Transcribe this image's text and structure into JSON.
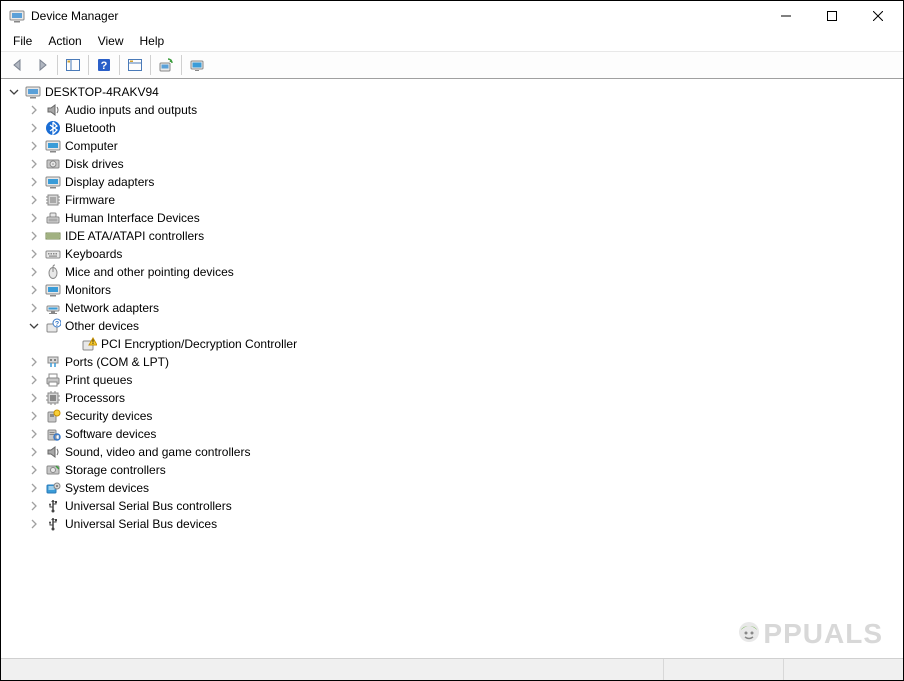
{
  "window": {
    "title": "Device Manager"
  },
  "menus": {
    "file": "File",
    "action": "Action",
    "view": "View",
    "help": "Help"
  },
  "root": {
    "label": "DESKTOP-4RAKV94"
  },
  "categories": [
    {
      "label": "Audio inputs and outputs",
      "icon": "speaker"
    },
    {
      "label": "Bluetooth",
      "icon": "bluetooth"
    },
    {
      "label": "Computer",
      "icon": "monitor"
    },
    {
      "label": "Disk drives",
      "icon": "disk"
    },
    {
      "label": "Display adapters",
      "icon": "monitor"
    },
    {
      "label": "Firmware",
      "icon": "chip"
    },
    {
      "label": "Human Interface Devices",
      "icon": "hid"
    },
    {
      "label": "IDE ATA/ATAPI controllers",
      "icon": "ide"
    },
    {
      "label": "Keyboards",
      "icon": "keyboard"
    },
    {
      "label": "Mice and other pointing devices",
      "icon": "mouse"
    },
    {
      "label": "Monitors",
      "icon": "monitor"
    },
    {
      "label": "Network adapters",
      "icon": "network"
    },
    {
      "label": "Other devices",
      "icon": "question",
      "expanded": true,
      "children": [
        {
          "label": "PCI Encryption/Decryption Controller",
          "icon": "warning"
        }
      ]
    },
    {
      "label": "Ports (COM & LPT)",
      "icon": "port"
    },
    {
      "label": "Print queues",
      "icon": "printer"
    },
    {
      "label": "Processors",
      "icon": "cpu"
    },
    {
      "label": "Security devices",
      "icon": "security"
    },
    {
      "label": "Software devices",
      "icon": "software"
    },
    {
      "label": "Sound, video and game controllers",
      "icon": "speaker"
    },
    {
      "label": "Storage controllers",
      "icon": "storage"
    },
    {
      "label": "System devices",
      "icon": "system"
    },
    {
      "label": "Universal Serial Bus controllers",
      "icon": "usb"
    },
    {
      "label": "Universal Serial Bus devices",
      "icon": "usb"
    }
  ],
  "watermark": {
    "text": "PPUALS"
  }
}
